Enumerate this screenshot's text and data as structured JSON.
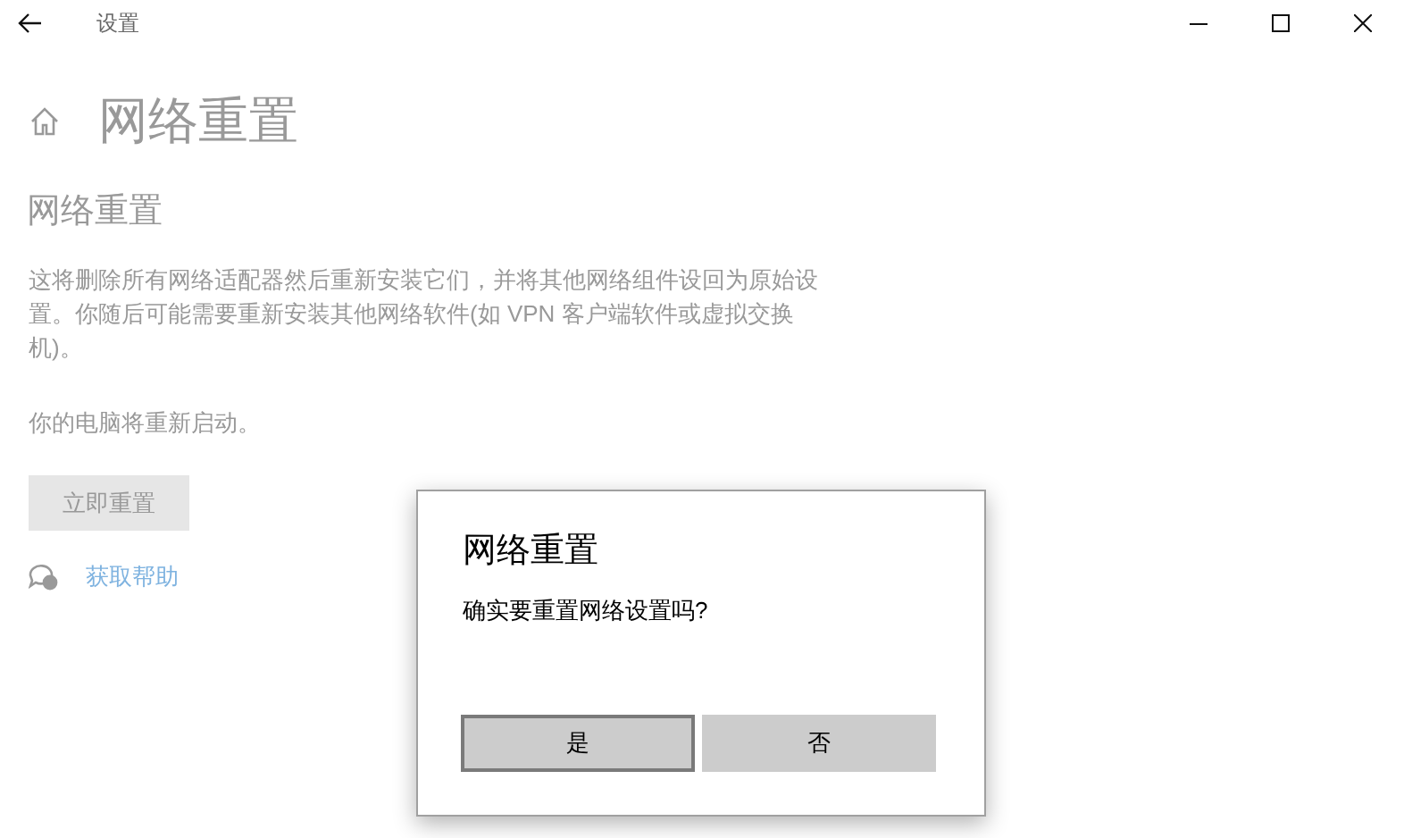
{
  "window": {
    "title": "设置"
  },
  "page_title": "网络重置",
  "section_title": "网络重置",
  "description": "这将删除所有网络适配器然后重新安装它们，并将其他网络组件设回为原始设置。你随后可能需要重新安装其他网络软件(如 VPN 客户端软件或虚拟交换机)。",
  "note": "你的电脑将重新启动。",
  "reset_button": {
    "label": "立即重置",
    "disabled": true
  },
  "help_link": "获取帮助",
  "dialog": {
    "title": "网络重置",
    "message": "确实要重置网络设置吗?",
    "buttons": [
      {
        "label": "是",
        "selected": true
      },
      {
        "label": "否",
        "selected": false
      }
    ]
  }
}
